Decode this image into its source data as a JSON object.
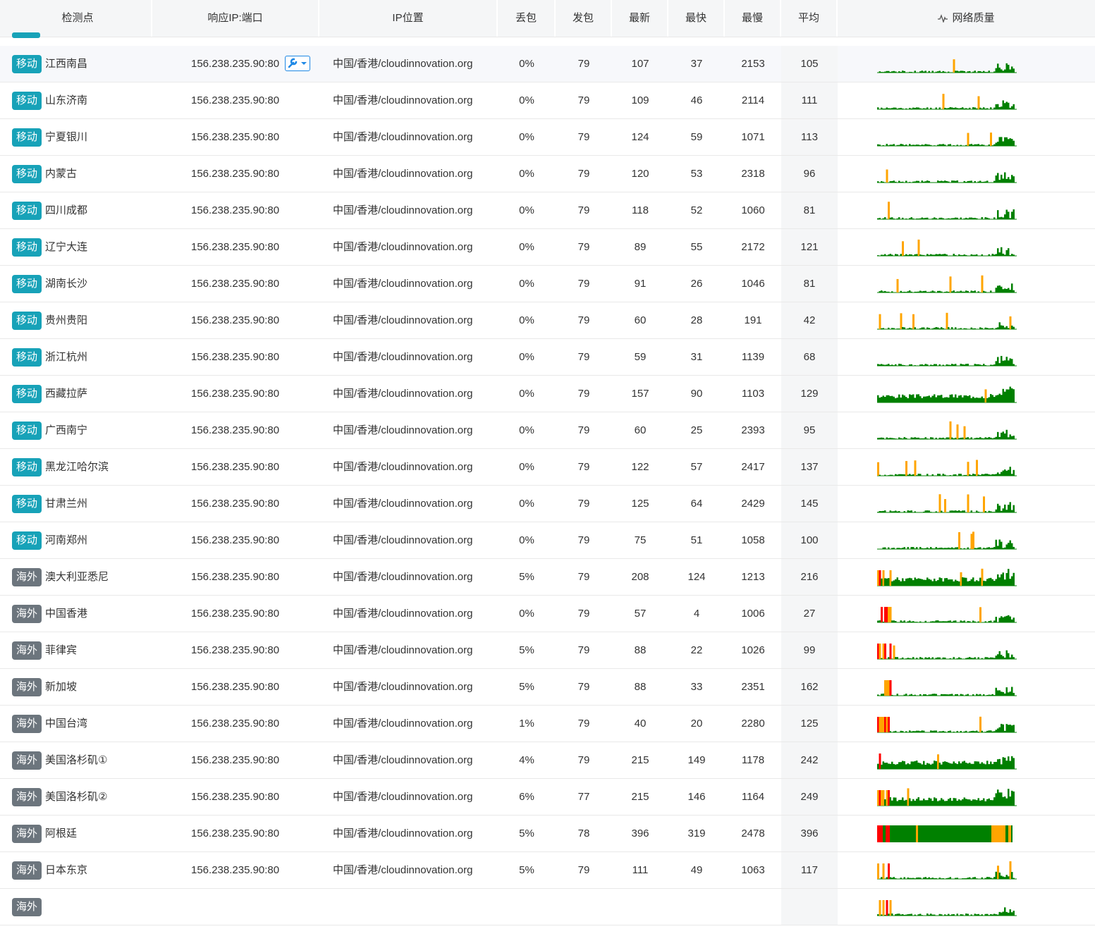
{
  "header": {
    "col_point": "检测点",
    "col_ip": "响应IP:端口",
    "col_loc": "IP位置",
    "col_loss": "丢包",
    "col_sent": "发包",
    "col_latest": "最新",
    "col_fastest": "最快",
    "col_slowest": "最慢",
    "col_avg": "平均",
    "col_quality": "网络质量"
  },
  "colors": {
    "mobile_badge": "#17a2b8",
    "overseas_badge": "#6c757d",
    "good": "#008000",
    "warn": "#ffa500",
    "bad": "#ff0000",
    "tool_accent": "#1e88e5"
  },
  "rows": [
    {
      "tag": "移动",
      "name": "江西南昌",
      "ip": "156.238.235.90:80",
      "loc": "中国/香港/cloudinnovation.org",
      "loss": "0%",
      "sent": "79",
      "latest": "107",
      "fastest": "37",
      "slowest": "2153",
      "avg": "105"
    },
    {
      "tag": "移动",
      "name": "山东济南",
      "ip": "156.238.235.90:80",
      "loc": "中国/香港/cloudinnovation.org",
      "loss": "0%",
      "sent": "79",
      "latest": "109",
      "fastest": "46",
      "slowest": "2114",
      "avg": "111"
    },
    {
      "tag": "移动",
      "name": "宁夏银川",
      "ip": "156.238.235.90:80",
      "loc": "中国/香港/cloudinnovation.org",
      "loss": "0%",
      "sent": "79",
      "latest": "124",
      "fastest": "59",
      "slowest": "1071",
      "avg": "113"
    },
    {
      "tag": "移动",
      "name": "内蒙古",
      "ip": "156.238.235.90:80",
      "loc": "中国/香港/cloudinnovation.org",
      "loss": "0%",
      "sent": "79",
      "latest": "120",
      "fastest": "53",
      "slowest": "2318",
      "avg": "96"
    },
    {
      "tag": "移动",
      "name": "四川成都",
      "ip": "156.238.235.90:80",
      "loc": "中国/香港/cloudinnovation.org",
      "loss": "0%",
      "sent": "79",
      "latest": "118",
      "fastest": "52",
      "slowest": "1060",
      "avg": "81"
    },
    {
      "tag": "移动",
      "name": "辽宁大连",
      "ip": "156.238.235.90:80",
      "loc": "中国/香港/cloudinnovation.org",
      "loss": "0%",
      "sent": "79",
      "latest": "89",
      "fastest": "55",
      "slowest": "2172",
      "avg": "121"
    },
    {
      "tag": "移动",
      "name": "湖南长沙",
      "ip": "156.238.235.90:80",
      "loc": "中国/香港/cloudinnovation.org",
      "loss": "0%",
      "sent": "79",
      "latest": "91",
      "fastest": "26",
      "slowest": "1046",
      "avg": "81"
    },
    {
      "tag": "移动",
      "name": "贵州贵阳",
      "ip": "156.238.235.90:80",
      "loc": "中国/香港/cloudinnovation.org",
      "loss": "0%",
      "sent": "79",
      "latest": "60",
      "fastest": "28",
      "slowest": "191",
      "avg": "42"
    },
    {
      "tag": "移动",
      "name": "浙江杭州",
      "ip": "156.238.235.90:80",
      "loc": "中国/香港/cloudinnovation.org",
      "loss": "0%",
      "sent": "79",
      "latest": "59",
      "fastest": "31",
      "slowest": "1139",
      "avg": "68"
    },
    {
      "tag": "移动",
      "name": "西藏拉萨",
      "ip": "156.238.235.90:80",
      "loc": "中国/香港/cloudinnovation.org",
      "loss": "0%",
      "sent": "79",
      "latest": "157",
      "fastest": "90",
      "slowest": "1103",
      "avg": "129"
    },
    {
      "tag": "移动",
      "name": "广西南宁",
      "ip": "156.238.235.90:80",
      "loc": "中国/香港/cloudinnovation.org",
      "loss": "0%",
      "sent": "79",
      "latest": "60",
      "fastest": "25",
      "slowest": "2393",
      "avg": "95"
    },
    {
      "tag": "移动",
      "name": "黑龙江哈尔滨",
      "ip": "156.238.235.90:80",
      "loc": "中国/香港/cloudinnovation.org",
      "loss": "0%",
      "sent": "79",
      "latest": "122",
      "fastest": "57",
      "slowest": "2417",
      "avg": "137"
    },
    {
      "tag": "移动",
      "name": "甘肃兰州",
      "ip": "156.238.235.90:80",
      "loc": "中国/香港/cloudinnovation.org",
      "loss": "0%",
      "sent": "79",
      "latest": "125",
      "fastest": "64",
      "slowest": "2429",
      "avg": "145"
    },
    {
      "tag": "移动",
      "name": "河南郑州",
      "ip": "156.238.235.90:80",
      "loc": "中国/香港/cloudinnovation.org",
      "loss": "0%",
      "sent": "79",
      "latest": "75",
      "fastest": "51",
      "slowest": "1058",
      "avg": "100"
    },
    {
      "tag": "海外",
      "name": "澳大利亚悉尼",
      "ip": "156.238.235.90:80",
      "loc": "中国/香港/cloudinnovation.org",
      "loss": "5%",
      "sent": "79",
      "latest": "208",
      "fastest": "124",
      "slowest": "1213",
      "avg": "216"
    },
    {
      "tag": "海外",
      "name": "中国香港",
      "ip": "156.238.235.90:80",
      "loc": "中国/香港/cloudinnovation.org",
      "loss": "0%",
      "sent": "79",
      "latest": "57",
      "fastest": "4",
      "slowest": "1006",
      "avg": "27"
    },
    {
      "tag": "海外",
      "name": "菲律宾",
      "ip": "156.238.235.90:80",
      "loc": "中国/香港/cloudinnovation.org",
      "loss": "5%",
      "sent": "79",
      "latest": "88",
      "fastest": "22",
      "slowest": "1026",
      "avg": "99"
    },
    {
      "tag": "海外",
      "name": "新加坡",
      "ip": "156.238.235.90:80",
      "loc": "中国/香港/cloudinnovation.org",
      "loss": "5%",
      "sent": "79",
      "latest": "88",
      "fastest": "33",
      "slowest": "2351",
      "avg": "162"
    },
    {
      "tag": "海外",
      "name": "中国台湾",
      "ip": "156.238.235.90:80",
      "loc": "中国/香港/cloudinnovation.org",
      "loss": "1%",
      "sent": "79",
      "latest": "40",
      "fastest": "20",
      "slowest": "2280",
      "avg": "125"
    },
    {
      "tag": "海外",
      "name": "美国洛杉矶①",
      "ip": "156.238.235.90:80",
      "loc": "中国/香港/cloudinnovation.org",
      "loss": "4%",
      "sent": "79",
      "latest": "215",
      "fastest": "149",
      "slowest": "1178",
      "avg": "242"
    },
    {
      "tag": "海外",
      "name": "美国洛杉矶②",
      "ip": "156.238.235.90:80",
      "loc": "中国/香港/cloudinnovation.org",
      "loss": "6%",
      "sent": "77",
      "latest": "215",
      "fastest": "146",
      "slowest": "1164",
      "avg": "249"
    },
    {
      "tag": "海外",
      "name": "阿根廷",
      "ip": "156.238.235.90:80",
      "loc": "中国/香港/cloudinnovation.org",
      "loss": "5%",
      "sent": "78",
      "latest": "396",
      "fastest": "319",
      "slowest": "2478",
      "avg": "396"
    },
    {
      "tag": "海外",
      "name": "日本东京",
      "ip": "156.238.235.90:80",
      "loc": "中国/香港/cloudinnovation.org",
      "loss": "5%",
      "sent": "79",
      "latest": "111",
      "fastest": "49",
      "slowest": "1063",
      "avg": "117"
    },
    {
      "tag": "海外",
      "name": "",
      "ip": "",
      "loc": "",
      "loss": "",
      "sent": "",
      "latest": "",
      "fastest": "",
      "slowest": "",
      "avg": ""
    }
  ]
}
